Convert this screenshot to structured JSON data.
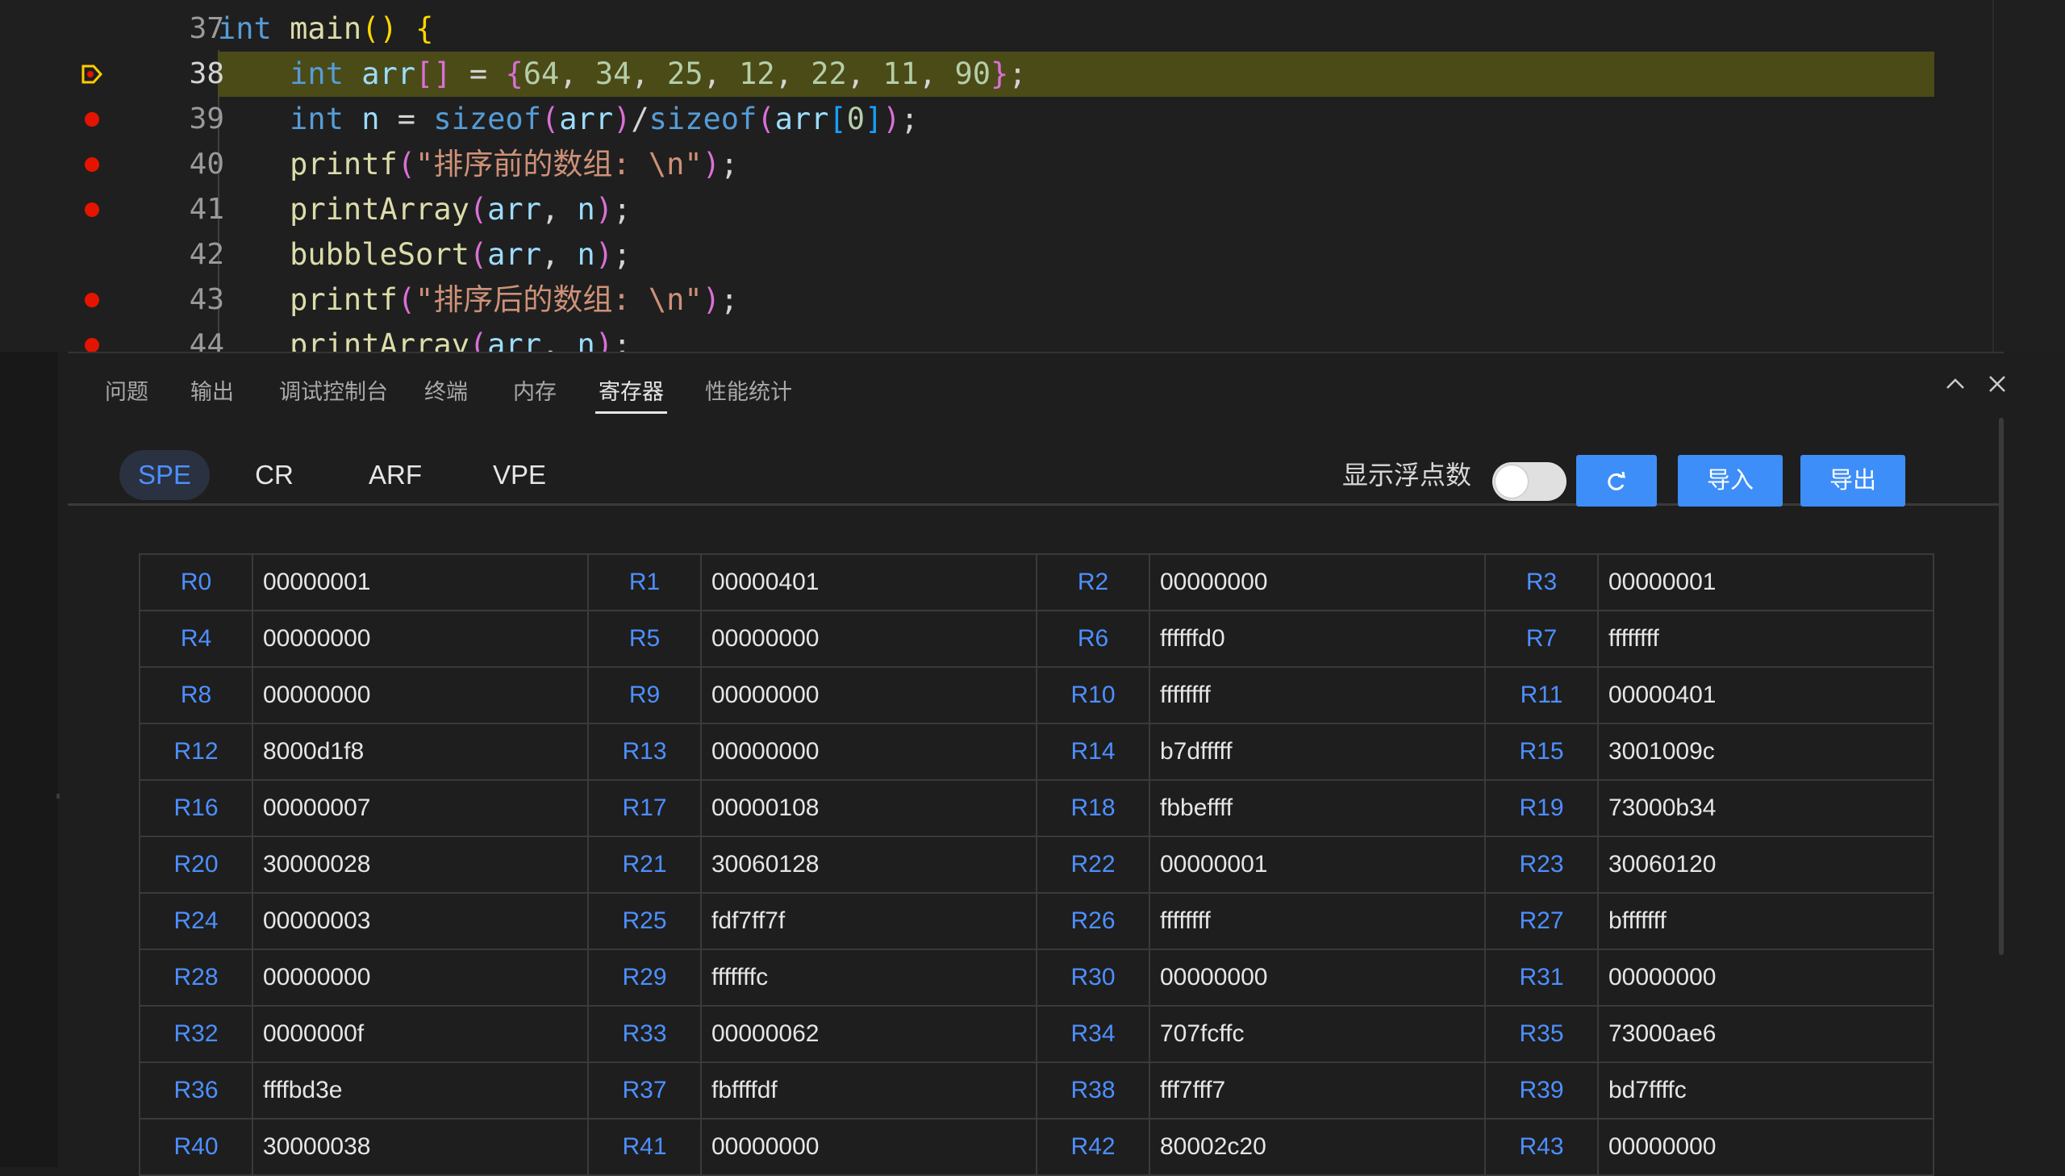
{
  "editor": {
    "lines": [
      {
        "num": "37",
        "marker": "none",
        "tokens": [
          [
            "kw",
            "int"
          ],
          [
            "plain",
            " "
          ],
          [
            "fn",
            "main"
          ],
          [
            "b1",
            "()"
          ],
          [
            "plain",
            " "
          ],
          [
            "b1",
            "{"
          ]
        ]
      },
      {
        "num": "38",
        "marker": "current",
        "tokens": [
          [
            "plain",
            "    "
          ],
          [
            "kw",
            "int"
          ],
          [
            "plain",
            " "
          ],
          [
            "var",
            "arr"
          ],
          [
            "b2",
            "[]"
          ],
          [
            "plain",
            " = "
          ],
          [
            "b2",
            "{"
          ],
          [
            "num",
            "64"
          ],
          [
            "plain",
            ", "
          ],
          [
            "num",
            "34"
          ],
          [
            "plain",
            ", "
          ],
          [
            "num",
            "25"
          ],
          [
            "plain",
            ", "
          ],
          [
            "num",
            "12"
          ],
          [
            "plain",
            ", "
          ],
          [
            "num",
            "22"
          ],
          [
            "plain",
            ", "
          ],
          [
            "num",
            "11"
          ],
          [
            "plain",
            ", "
          ],
          [
            "num",
            "90"
          ],
          [
            "b2",
            "}"
          ],
          [
            "plain",
            ";"
          ]
        ]
      },
      {
        "num": "39",
        "marker": "breakpoint",
        "tokens": [
          [
            "plain",
            "    "
          ],
          [
            "kw",
            "int"
          ],
          [
            "plain",
            " "
          ],
          [
            "var",
            "n"
          ],
          [
            "plain",
            " = "
          ],
          [
            "kw",
            "sizeof"
          ],
          [
            "b2",
            "("
          ],
          [
            "var",
            "arr"
          ],
          [
            "b2",
            ")"
          ],
          [
            "plain",
            "/"
          ],
          [
            "kw",
            "sizeof"
          ],
          [
            "b2",
            "("
          ],
          [
            "var",
            "arr"
          ],
          [
            "b3",
            "["
          ],
          [
            "num",
            "0"
          ],
          [
            "b3",
            "]"
          ],
          [
            "b2",
            ")"
          ],
          [
            "plain",
            ";"
          ]
        ]
      },
      {
        "num": "40",
        "marker": "breakpoint",
        "tokens": [
          [
            "plain",
            "    "
          ],
          [
            "fn",
            "printf"
          ],
          [
            "b2",
            "("
          ],
          [
            "str",
            "\"排序前的数组: \\n\""
          ],
          [
            "b2",
            ")"
          ],
          [
            "plain",
            ";"
          ]
        ]
      },
      {
        "num": "41",
        "marker": "breakpoint",
        "tokens": [
          [
            "plain",
            "    "
          ],
          [
            "fn",
            "printArray"
          ],
          [
            "b2",
            "("
          ],
          [
            "var",
            "arr"
          ],
          [
            "plain",
            ", "
          ],
          [
            "var",
            "n"
          ],
          [
            "b2",
            ")"
          ],
          [
            "plain",
            ";"
          ]
        ]
      },
      {
        "num": "42",
        "marker": "none",
        "tokens": [
          [
            "plain",
            "    "
          ],
          [
            "fn",
            "bubbleSort"
          ],
          [
            "b2",
            "("
          ],
          [
            "var",
            "arr"
          ],
          [
            "plain",
            ", "
          ],
          [
            "var",
            "n"
          ],
          [
            "b2",
            ")"
          ],
          [
            "plain",
            ";"
          ]
        ]
      },
      {
        "num": "43",
        "marker": "breakpoint",
        "tokens": [
          [
            "plain",
            "    "
          ],
          [
            "fn",
            "printf"
          ],
          [
            "b2",
            "("
          ],
          [
            "str",
            "\"排序后的数组: \\n\""
          ],
          [
            "b2",
            ")"
          ],
          [
            "plain",
            ";"
          ]
        ]
      },
      {
        "num": "44",
        "marker": "breakpoint",
        "tokens": [
          [
            "plain",
            "    "
          ],
          [
            "fn",
            "printArray"
          ],
          [
            "b2",
            "("
          ],
          [
            "var",
            "arr"
          ],
          [
            "plain",
            ", "
          ],
          [
            "var",
            "n"
          ],
          [
            "b2",
            ")"
          ],
          [
            "plain",
            ";"
          ]
        ]
      }
    ]
  },
  "panel": {
    "tabs": [
      "问题",
      "输出",
      "调试控制台",
      "终端",
      "内存",
      "寄存器",
      "性能统计"
    ],
    "active_tab": "寄存器",
    "subtabs": [
      "SPE",
      "CR",
      "ARF",
      "VPE"
    ],
    "active_subtab": "SPE",
    "float_label": "显示浮点数",
    "float_toggle_on": false,
    "refresh_icon": "refresh-icon",
    "import_label": "导入",
    "export_label": "导出",
    "collapse_icon": "chevron-up-icon",
    "close_icon": "close-icon"
  },
  "registers": [
    [
      "R0",
      "00000001",
      "R1",
      "00000401",
      "R2",
      "00000000",
      "R3",
      "00000001"
    ],
    [
      "R4",
      "00000000",
      "R5",
      "00000000",
      "R6",
      "ffffffd0",
      "R7",
      "ffffffff"
    ],
    [
      "R8",
      "00000000",
      "R9",
      "00000000",
      "R10",
      "ffffffff",
      "R11",
      "00000401"
    ],
    [
      "R12",
      "8000d1f8",
      "R13",
      "00000000",
      "R14",
      "b7dfffff",
      "R15",
      "3001009c"
    ],
    [
      "R16",
      "00000007",
      "R17",
      "00000108",
      "R18",
      "fbbeffff",
      "R19",
      "73000b34"
    ],
    [
      "R20",
      "30000028",
      "R21",
      "30060128",
      "R22",
      "00000001",
      "R23",
      "30060120"
    ],
    [
      "R24",
      "00000003",
      "R25",
      "fdf7ff7f",
      "R26",
      "ffffffff",
      "R27",
      "bfffffff"
    ],
    [
      "R28",
      "00000000",
      "R29",
      "fffffffc",
      "R30",
      "00000000",
      "R31",
      "00000000"
    ],
    [
      "R32",
      "0000000f",
      "R33",
      "00000062",
      "R34",
      "707fcffc",
      "R35",
      "73000ae6"
    ],
    [
      "R36",
      "ffffbd3e",
      "R37",
      "fbffffdf",
      "R38",
      "fff7fff7",
      "R39",
      "bd7ffffc"
    ],
    [
      "R40",
      "30000038",
      "R41",
      "00000000",
      "R42",
      "80002c20",
      "R43",
      "00000000"
    ]
  ],
  "colors": {
    "accent": "#3d8ef8",
    "reg_name": "#4d8fff",
    "current_line_bg": "#4b4b18",
    "breakpoint": "#e51400"
  }
}
